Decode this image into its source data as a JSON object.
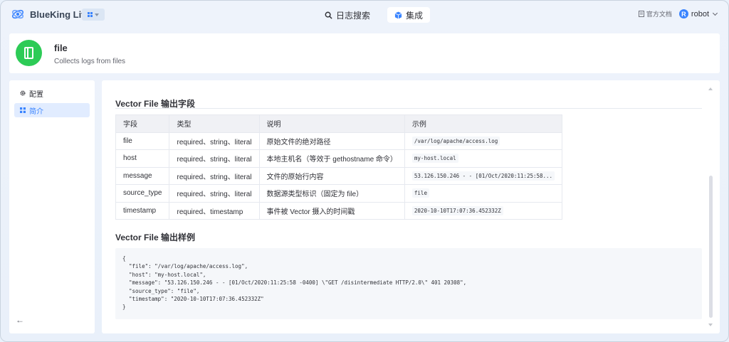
{
  "brand": {
    "name": "BlueKing Lite"
  },
  "nav": {
    "tabs": [
      {
        "label": "日志搜索",
        "icon": "search-icon"
      },
      {
        "label": "集成",
        "icon": "cube-icon",
        "active": true
      }
    ],
    "doc_link": "官方文档",
    "user": {
      "avatar_letter": "R",
      "name": "robot"
    }
  },
  "plugin": {
    "title": "file",
    "description": "Collects logs from files",
    "icon": "book-icon",
    "icon_color": "#2dcb56"
  },
  "sidebar": {
    "items": [
      {
        "label": "配置",
        "icon": "gear-icon"
      },
      {
        "label": "简介",
        "icon": "grid-icon",
        "active": true
      }
    ],
    "collapse_icon": "arrow-left-icon"
  },
  "fields_section": {
    "title": "Vector File 输出字段",
    "headers": [
      "字段",
      "类型",
      "说明",
      "示例"
    ],
    "rows": [
      [
        "file",
        "required、string、literal",
        "原始文件的绝对路径",
        "/var/log/apache/access.log"
      ],
      [
        "host",
        "required、string、literal",
        "本地主机名（等效于 gethostname 命令）",
        "my-host.local"
      ],
      [
        "message",
        "required、string、literal",
        "文件的原始行内容",
        "53.126.150.246 - - [01/Oct/2020:11:25:58..."
      ],
      [
        "source_type",
        "required、string、literal",
        "数据源类型标识（固定为 file）",
        "file"
      ],
      [
        "timestamp",
        "required、timestamp",
        "事件被 Vector 摄入的时间戳",
        "2020-10-10T17:07:36.452332Z"
      ]
    ]
  },
  "sample_section": {
    "title": "Vector File 输出样例",
    "code": "{\n  \"file\": \"/var/log/apache/access.log\",\n  \"host\": \"my-host.local\",\n  \"message\": \"53.126.150.246 - - [01/Oct/2020:11:25:58 -0400] \\\"GET /disintermediate HTTP/2.0\\\" 401 20308\",\n  \"source_type\": \"file\",\n  \"timestamp\": \"2020-10-10T17:07:36.452332Z\"\n}"
  },
  "colors": {
    "accent": "#3a84ff",
    "active_bg": "#e1ecff"
  }
}
